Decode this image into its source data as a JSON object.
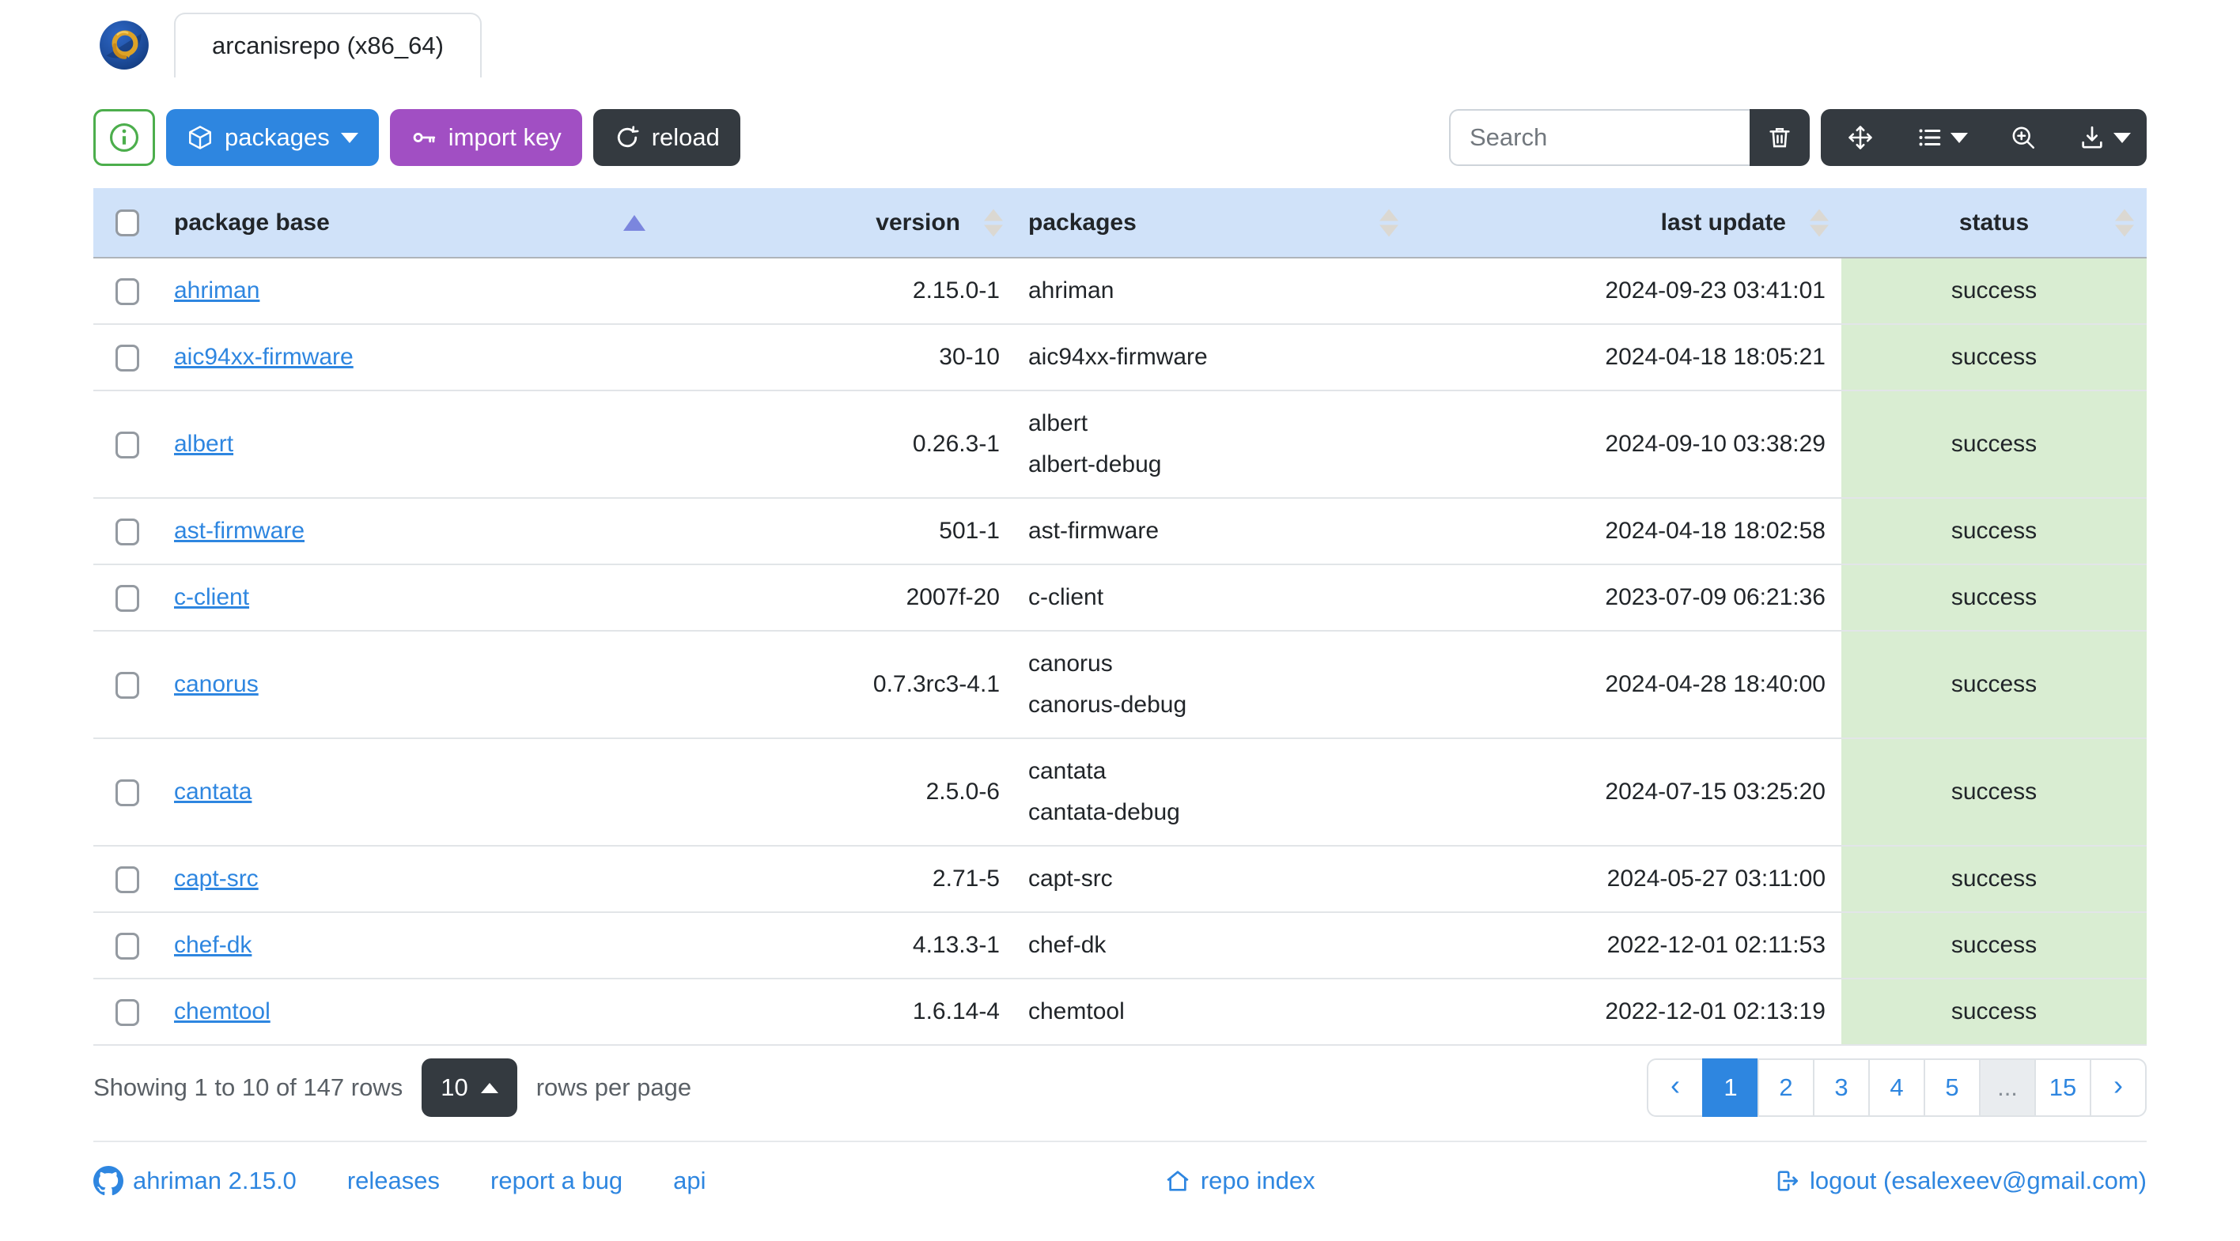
{
  "app": {
    "tab_title": "arcanisrepo (x86_64)",
    "logo_name": "ahriman-dragon-logo"
  },
  "toolbar": {
    "info_button_icon": "info-circle-icon",
    "packages_label": "packages",
    "import_key_label": "import key",
    "reload_label": "reload",
    "search_placeholder": "Search",
    "icons": [
      "trash-icon",
      "arrows-move-icon",
      "columns-list-icon",
      "zoom-in-icon",
      "download-icon"
    ]
  },
  "table": {
    "headers": {
      "package_base": "package base",
      "version": "version",
      "packages": "packages",
      "last_update": "last update",
      "status": "status"
    },
    "sorted_by": "package_base",
    "sort_direction": "asc",
    "rows": [
      {
        "base": "ahriman",
        "version": "2.15.0-1",
        "packages": [
          "ahriman"
        ],
        "last_update": "2024-09-23 03:41:01",
        "status": "success"
      },
      {
        "base": "aic94xx-firmware",
        "version": "30-10",
        "packages": [
          "aic94xx-firmware"
        ],
        "last_update": "2024-04-18 18:05:21",
        "status": "success"
      },
      {
        "base": "albert",
        "version": "0.26.3-1",
        "packages": [
          "albert",
          "albert-debug"
        ],
        "last_update": "2024-09-10 03:38:29",
        "status": "success"
      },
      {
        "base": "ast-firmware",
        "version": "501-1",
        "packages": [
          "ast-firmware"
        ],
        "last_update": "2024-04-18 18:02:58",
        "status": "success"
      },
      {
        "base": "c-client",
        "version": "2007f-20",
        "packages": [
          "c-client"
        ],
        "last_update": "2023-07-09 06:21:36",
        "status": "success"
      },
      {
        "base": "canorus",
        "version": "0.7.3rc3-4.1",
        "packages": [
          "canorus",
          "canorus-debug"
        ],
        "last_update": "2024-04-28 18:40:00",
        "status": "success"
      },
      {
        "base": "cantata",
        "version": "2.5.0-6",
        "packages": [
          "cantata",
          "cantata-debug"
        ],
        "last_update": "2024-07-15 03:25:20",
        "status": "success"
      },
      {
        "base": "capt-src",
        "version": "2.71-5",
        "packages": [
          "capt-src"
        ],
        "last_update": "2024-05-27 03:11:00",
        "status": "success"
      },
      {
        "base": "chef-dk",
        "version": "4.13.3-1",
        "packages": [
          "chef-dk"
        ],
        "last_update": "2022-12-01 02:11:53",
        "status": "success"
      },
      {
        "base": "chemtool",
        "version": "1.6.14-4",
        "packages": [
          "chemtool"
        ],
        "last_update": "2022-12-01 02:13:19",
        "status": "success"
      }
    ]
  },
  "table_footer": {
    "showing_text": "Showing 1 to 10 of 147 rows",
    "page_size": "10",
    "rows_per_page_text": "rows per page",
    "pagination": {
      "prev": "‹",
      "next": "›",
      "pages": [
        "1",
        "2",
        "3",
        "4",
        "5",
        "...",
        "15"
      ],
      "active_page": "1",
      "disabled_page": "..."
    }
  },
  "footer": {
    "version_link": "ahriman 2.15.0",
    "releases_link": "releases",
    "report_bug_link": "report a bug",
    "api_link": "api",
    "repo_index_link": "repo index",
    "logout_link": "logout (esalexeev@gmail.com)"
  },
  "colors": {
    "primary_blue": "#2e86e0",
    "purple": "#a14fc3",
    "dark": "#343a40",
    "success_green": "#4cae4c",
    "header_bg": "#d0e2f9",
    "status_bg": "#d9edd2",
    "active_sort_caret": "#7b86de",
    "link_blue": "#2e86e0"
  }
}
